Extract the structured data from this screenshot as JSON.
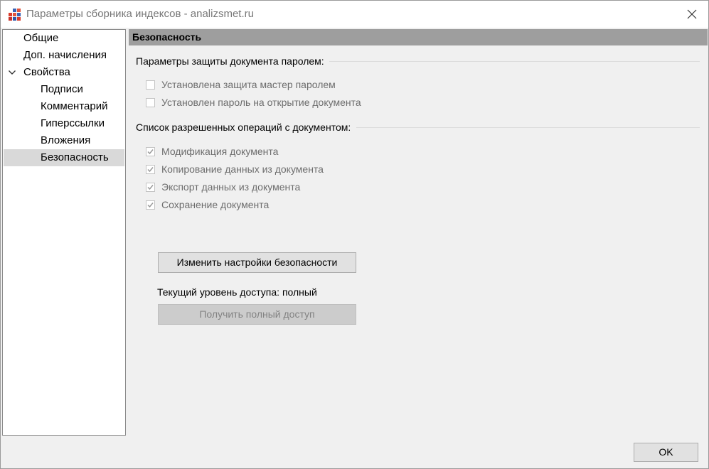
{
  "window": {
    "title": "Параметры сборника индексов - analizsmet.ru"
  },
  "tree": {
    "items": [
      {
        "label": "Общие"
      },
      {
        "label": "Доп. начисления"
      },
      {
        "label": "Свойства",
        "expanded": true
      },
      {
        "label": "Подписи"
      },
      {
        "label": "Комментарий"
      },
      {
        "label": "Гиперссылки"
      },
      {
        "label": "Вложения"
      },
      {
        "label": "Безопасность",
        "selected": true
      }
    ]
  },
  "content": {
    "header": "Безопасность",
    "password_group": {
      "title": "Параметры защиты документа паролем:",
      "options": [
        {
          "label": "Установлена защита мастер паролем",
          "checked": false
        },
        {
          "label": "Установлен пароль на открытие документа",
          "checked": false
        }
      ]
    },
    "operations_group": {
      "title": "Список разрешенных операций с документом:",
      "options": [
        {
          "label": "Модификация документа",
          "checked": true
        },
        {
          "label": "Копирование данных из документа",
          "checked": true
        },
        {
          "label": "Экспорт данных из документа",
          "checked": true
        },
        {
          "label": "Сохранение документа",
          "checked": true
        }
      ]
    },
    "change_settings_label": "Изменить настройки безопасности",
    "access_level_text": "Текущий уровень доступа: полный",
    "get_full_access_label": "Получить полный доступ"
  },
  "footer": {
    "ok_label": "OK"
  },
  "colors": {
    "header_bg": "#9e9e9e",
    "selected_tree_bg": "#d9d9d9",
    "disabled_text": "#6d6d6d"
  }
}
